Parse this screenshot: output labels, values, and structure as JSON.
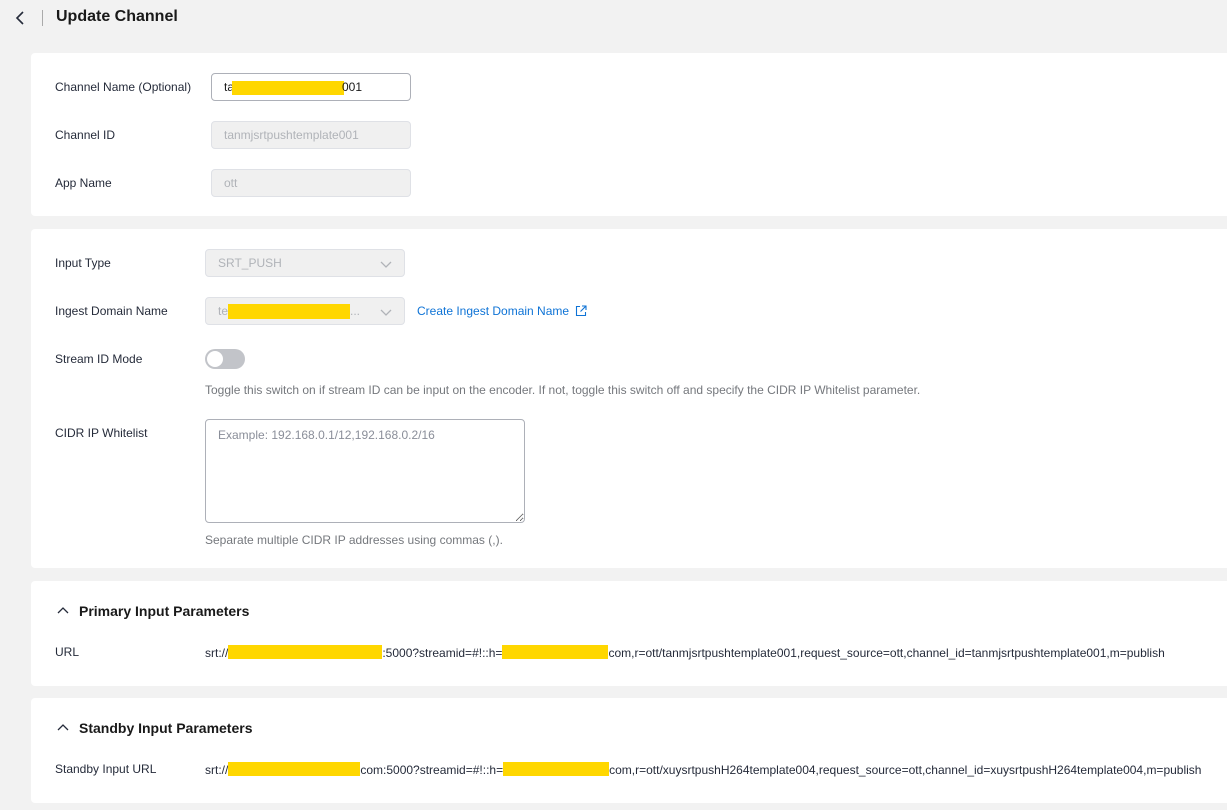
{
  "header": {
    "title": "Update Channel",
    "back_icon": "chevron-left-icon"
  },
  "basic": {
    "channel_name_label": "Channel Name (Optional)",
    "channel_name_prefix": "ta",
    "channel_name_suffix": "001",
    "channel_id_label": "Channel ID",
    "channel_id_value": "tanmjsrtpushtemplate001",
    "app_name_label": "App Name",
    "app_name_value": "ott"
  },
  "input": {
    "input_type_label": "Input Type",
    "input_type_value": "SRT_PUSH",
    "ingest_domain_label": "Ingest Domain Name",
    "ingest_domain_prefix": "te",
    "ingest_domain_ellipsis": "...",
    "create_domain_link": "Create Ingest Domain Name",
    "stream_id_mode_label": "Stream ID Mode",
    "stream_id_mode_on": false,
    "stream_id_hint": "Toggle this switch on if stream ID can be input on the encoder. If not, toggle this switch off and specify the CIDR IP Whitelist parameter.",
    "cidr_label": "CIDR IP Whitelist",
    "cidr_placeholder": "Example: 192.168.0.1/12,192.168.0.2/16",
    "cidr_hint": "Separate multiple CIDR IP addresses using commas (,)."
  },
  "primary": {
    "section_title": "Primary Input Parameters",
    "url_label": "URL",
    "url_part1": "srt://",
    "url_part2": ":5000?streamid=#!::h=",
    "url_part3": "com,r=ott/tanmjsrtpushtemplate001,request_source=ott,channel_id=tanmjsrtpushtemplate001,m=publish"
  },
  "standby": {
    "section_title": "Standby Input Parameters",
    "url_label": "Standby Input URL",
    "url_part1": "srt://",
    "url_part2": "com:5000?streamid=#!::h=",
    "url_part3": "com,r=ott/xuysrtpushH264template004,request_source=ott,channel_id=xuysrtpushH264template004,m=publish"
  },
  "colors": {
    "background": "#f2f2f2",
    "card": "#ffffff",
    "link": "#0e73d6",
    "redaction": "#ffd700"
  }
}
